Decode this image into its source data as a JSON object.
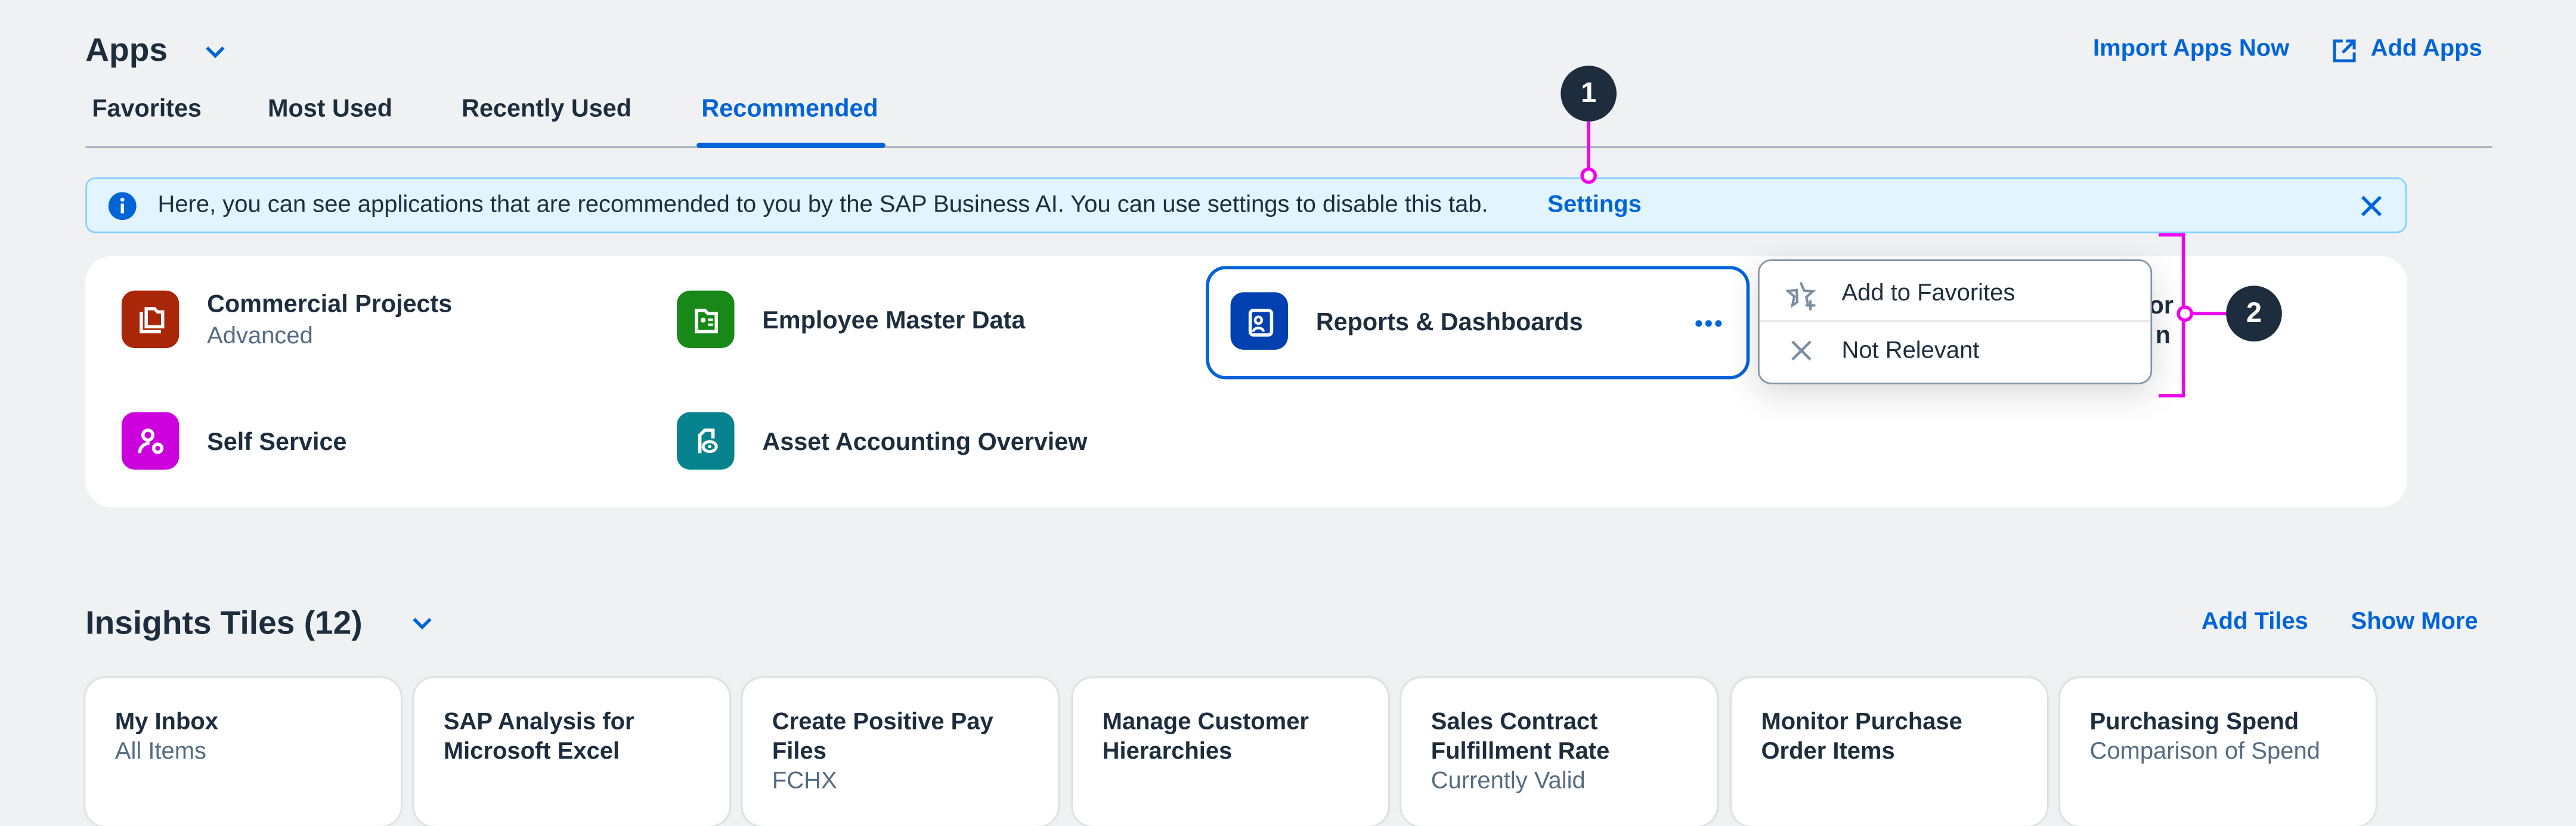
{
  "apps": {
    "title": "Apps",
    "tabs": [
      {
        "label": "Favorites",
        "active": false
      },
      {
        "label": "Most Used",
        "active": false
      },
      {
        "label": "Recently Used",
        "active": false
      },
      {
        "label": "Recommended",
        "active": true
      }
    ],
    "import_label": "Import Apps Now",
    "add_label": "Add Apps",
    "info": {
      "text": "Here, you can see applications that are recommended to you by the SAP Business AI. You can use settings to disable this tab.",
      "link": "Settings"
    },
    "items": [
      {
        "title": "Commercial Projects",
        "subtitle": "Advanced",
        "color": "#aa2608"
      },
      {
        "title": "Employee Master Data",
        "color": "#188918"
      },
      {
        "title": "Reports & Dashboards",
        "color": "#0040b0"
      },
      {
        "title": "Self Service",
        "color": "#cc00dc"
      },
      {
        "title": "Asset Accounting Overview",
        "color": "#07838f"
      }
    ],
    "hidden_fragments": [
      "or",
      "n"
    ],
    "menu": [
      {
        "label": "Add to Favorites",
        "icon": "star-add-icon"
      },
      {
        "label": "Not Relevant",
        "icon": "close-icon"
      }
    ]
  },
  "callouts": [
    "1",
    "2"
  ],
  "insights": {
    "title": "Insights Tiles (12)",
    "add_label": "Add Tiles",
    "more_label": "Show More",
    "tiles": [
      {
        "title": "My Inbox",
        "subtitle": "All Items"
      },
      {
        "title": "SAP Analysis for Microsoft Excel",
        "subtitle": ""
      },
      {
        "title": "Create Positive Pay Files",
        "subtitle": "FCHX"
      },
      {
        "title": "Manage Customer Hierarchies",
        "subtitle": ""
      },
      {
        "title": "Sales Contract Fulfillment Rate",
        "subtitle": "Currently Valid"
      },
      {
        "title": "Monitor Purchase Order Items",
        "subtitle": ""
      },
      {
        "title": "Purchasing Spend",
        "subtitle": "Comparison of Spend"
      }
    ]
  },
  "colors": {
    "accent": "#0064d9",
    "text": "#1d2d3e",
    "annotation": "#ee00ee"
  }
}
